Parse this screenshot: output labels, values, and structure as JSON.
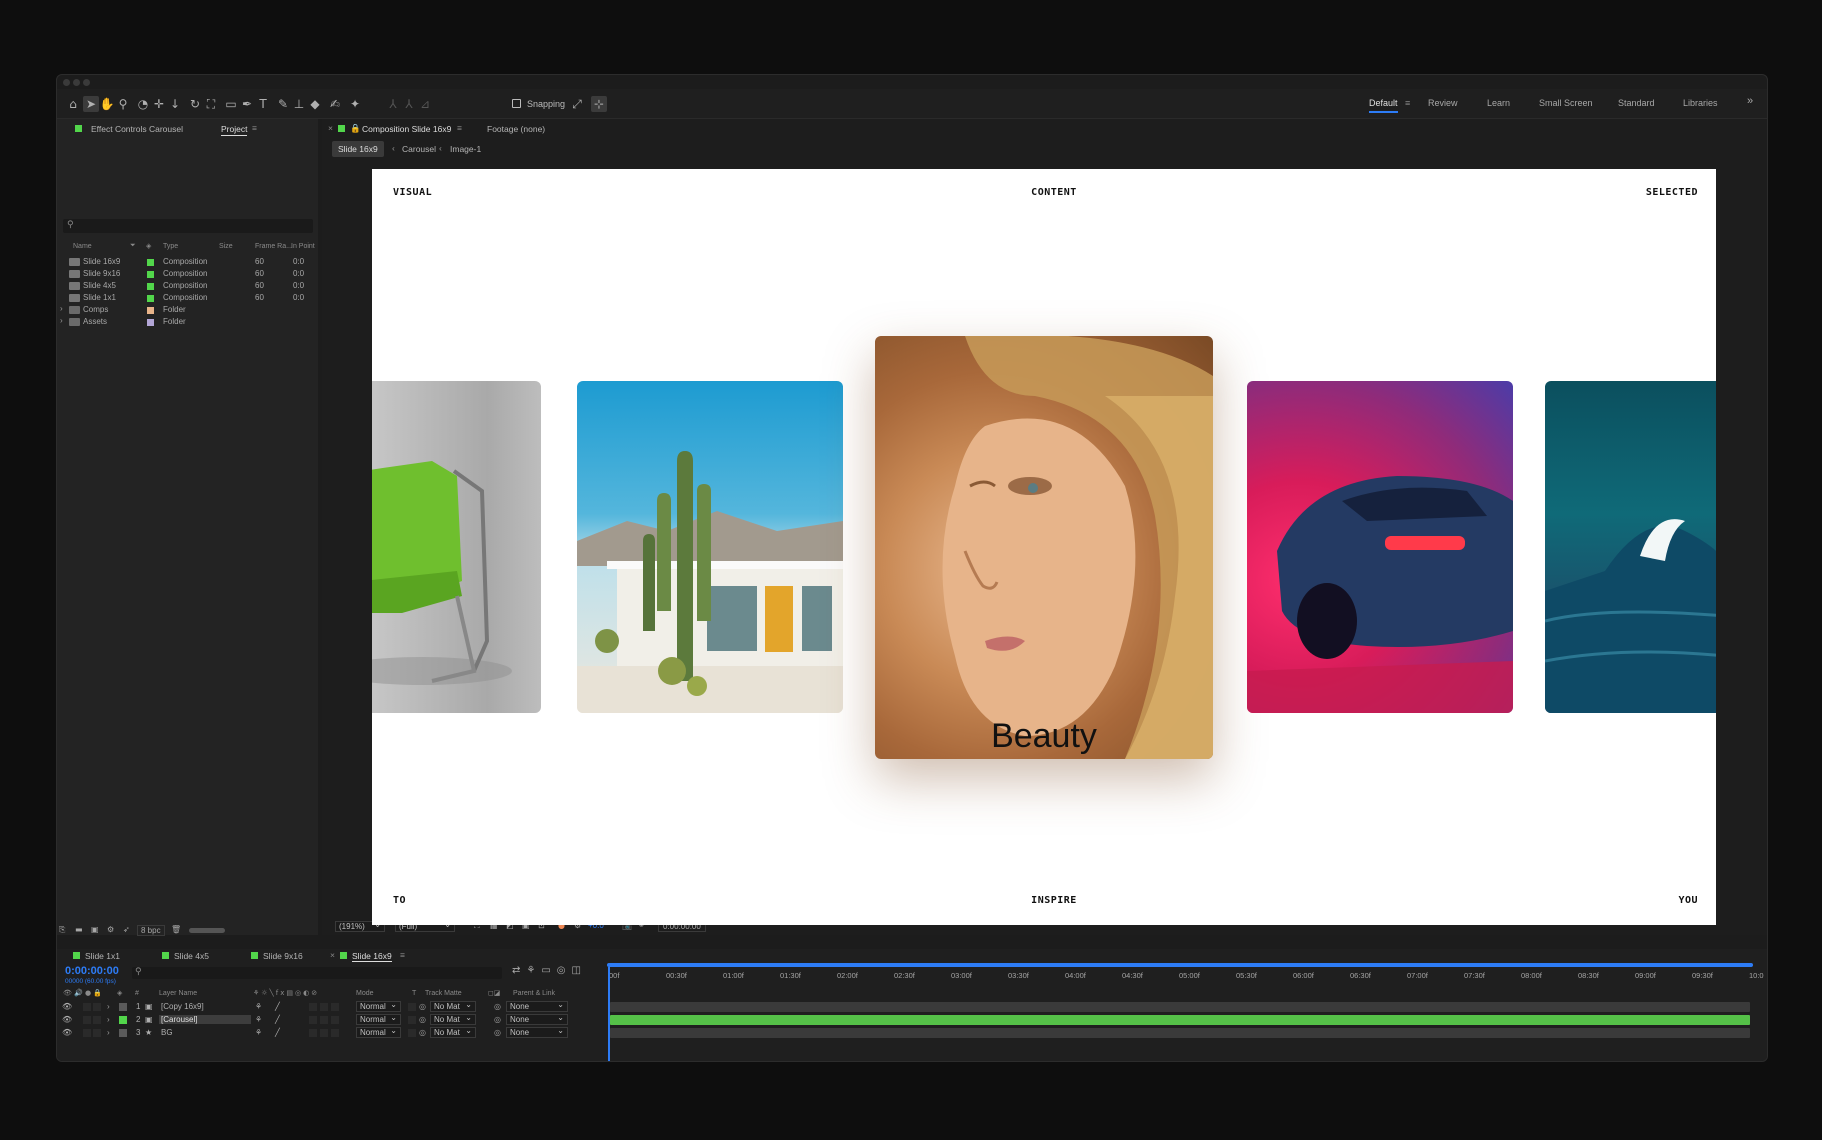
{
  "toolbar": {
    "snapping_label": "Snapping",
    "workspaces": [
      "Default",
      "Review",
      "Learn",
      "Small Screen",
      "Standard",
      "Libraries"
    ]
  },
  "project_panel": {
    "effect_controls_tab": "Effect Controls Carousel",
    "project_tab": "Project",
    "search_placeholder": "",
    "columns": [
      "Name",
      "Type",
      "Size",
      "Frame Ra...",
      "In Point"
    ],
    "items": [
      {
        "name": "Slide 16x9",
        "type": "Composition",
        "frame_rate": "60",
        "in_point": "0:0",
        "color": "#52d64b"
      },
      {
        "name": "Slide 9x16",
        "type": "Composition",
        "frame_rate": "60",
        "in_point": "0:0",
        "color": "#52d64b"
      },
      {
        "name": "Slide 4x5",
        "type": "Composition",
        "frame_rate": "60",
        "in_point": "0:0",
        "color": "#52d64b"
      },
      {
        "name": "Slide 1x1",
        "type": "Composition",
        "frame_rate": "60",
        "in_point": "0:0",
        "color": "#52d64b"
      },
      {
        "name": "Comps",
        "type": "Folder",
        "frame_rate": "",
        "in_point": "",
        "color": "#e8b48a"
      },
      {
        "name": "Assets",
        "type": "Folder",
        "frame_rate": "",
        "in_point": "",
        "color": "#b3a6d6"
      }
    ],
    "bit_depth": "8 bpc"
  },
  "composition_panel": {
    "tab_label": "Composition Slide 16x9",
    "footage_tab": "Footage (none)",
    "breadcrumbs": [
      "Slide 16x9",
      "Carousel",
      "Image-1"
    ],
    "zoom": "(191%)",
    "resolution": "(Full)",
    "exposure": "+0.0",
    "timecode": "0:00:00:00"
  },
  "canvas": {
    "top_left": "VISUAL",
    "top_center": "CONTENT",
    "top_right": "SELECTED",
    "bottom_left": "TO",
    "bottom_center": "INSPIRE",
    "bottom_right": "YOU",
    "caption": "Beauty"
  },
  "timeline": {
    "tabs": [
      "Slide 1x1",
      "Slide 4x5",
      "Slide 9x16",
      "Slide 16x9"
    ],
    "current_time": "0:00:00:00",
    "frame_info": "00000 (60.00 fps)",
    "columns": [
      "Layer Name",
      "Mode",
      "T",
      "Track Matte",
      "Parent & Link"
    ],
    "ticks": [
      "00f",
      "00:30f",
      "01:00f",
      "01:30f",
      "02:00f",
      "02:30f",
      "03:00f",
      "03:30f",
      "04:00f",
      "04:30f",
      "05:00f",
      "05:30f",
      "06:00f",
      "06:30f",
      "07:00f",
      "07:30f",
      "08:00f",
      "08:30f",
      "09:00f",
      "09:30f",
      "10:0"
    ],
    "layers": [
      {
        "num": "1",
        "name": "[Copy 16x9]",
        "mode": "Normal",
        "matte": "No Mat",
        "parent": "None",
        "color": "#5a5a5a"
      },
      {
        "num": "2",
        "name": "[Carousel]",
        "mode": "Normal",
        "matte": "No Mat",
        "parent": "None",
        "color": "#52d64b"
      },
      {
        "num": "3",
        "name": "BG",
        "mode": "Normal",
        "matte": "No Mat",
        "parent": "None",
        "color": "#5a5a5a"
      }
    ]
  },
  "colors": {
    "accent": "#2d7cf6",
    "label_green": "#52d64b",
    "track_green": "#55c148"
  }
}
